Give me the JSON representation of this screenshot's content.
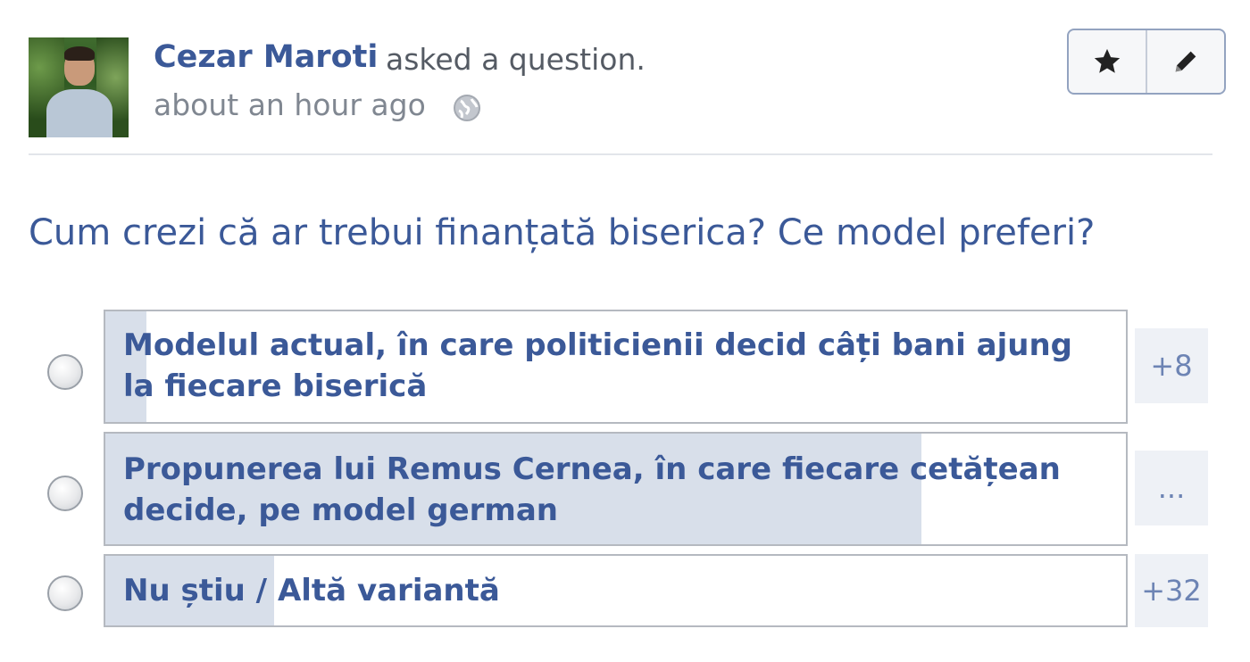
{
  "post": {
    "author": "Cezar Maroti",
    "action": "asked a question.",
    "timestamp": "about an hour ago",
    "privacy_icon": "globe-icon"
  },
  "actions": {
    "follow_icon": "star-icon",
    "edit_icon": "pencil-icon"
  },
  "question": "Cum crezi că ar trebui finanțată biserica? Ce model preferi?",
  "options": [
    {
      "label": "Modelul actual, în care politicienii decid câți bani ajung la fiecare biserică",
      "count": "+8",
      "fill_fraction": 0.04
    },
    {
      "label": "Propunerea lui Remus Cernea, în care fiecare cetățean decide, pe model german",
      "count": "...",
      "fill_fraction": 0.8
    },
    {
      "label": "Nu știu / Altă variantă",
      "count": "+32",
      "fill_fraction": 0.165
    }
  ],
  "colors": {
    "link": "#3b5998",
    "bar_fill": "#d8dfea"
  }
}
